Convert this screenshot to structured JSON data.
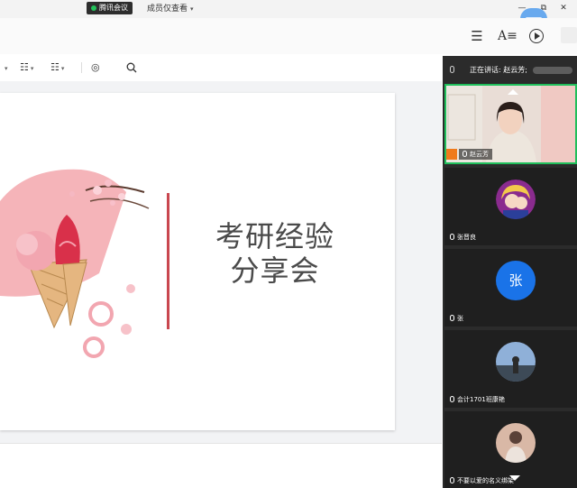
{
  "titlebar": {
    "meeting_app": "腾讯会议",
    "view_mode": "成员仅查看",
    "minimize": "—",
    "restore": "⧉",
    "close": "✕"
  },
  "header": {
    "menu_icon": "☰",
    "font_icon": "A≡"
  },
  "toolbar": {
    "list_icon": "☷",
    "numlist_icon": "☷",
    "shape_icon": "◎",
    "search_icon": "○",
    "caret": "▾"
  },
  "slide": {
    "title_line1": "考研经验",
    "title_line2": "分享会",
    "accent_color": "#c9474f"
  },
  "panel": {
    "speaking_label": "正在讲话: 赵云芳;",
    "participants": [
      {
        "name": "赵云芳",
        "active": true
      },
      {
        "name": "张晋良"
      },
      {
        "name": "张",
        "avatar_text": "张"
      },
      {
        "name": "会计1701班康艳"
      },
      {
        "name": "不要以爱的名义绑架"
      }
    ]
  },
  "colors": {
    "active_border": "#1fbf5b",
    "avatar_blue": "#1a73e8",
    "host_badge": "#f07a1b"
  }
}
